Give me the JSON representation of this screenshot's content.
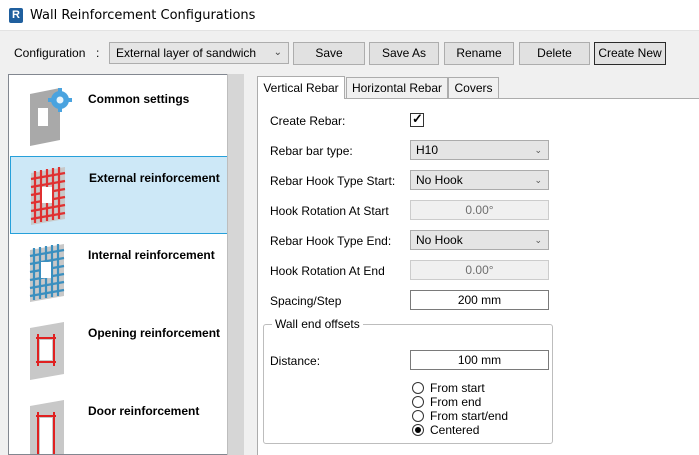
{
  "window": {
    "title": "Wall Reinforcement Configurations",
    "app_icon_letter": "R"
  },
  "toolbar": {
    "config_label": "Configuration",
    "config_colon": ":",
    "config_value": "External layer of sandwich",
    "save": "Save",
    "save_as": "Save As",
    "rename": "Rename",
    "delete": "Delete",
    "create_new": "Create New"
  },
  "sidebar": {
    "items": [
      {
        "label": "Common settings",
        "icon": "gear-wall-icon"
      },
      {
        "label": "External reinforcement",
        "icon": "red-mesh-wall-icon",
        "selected": true
      },
      {
        "label": "Internal reinforcement",
        "icon": "blue-mesh-wall-icon"
      },
      {
        "label": "Opening reinforcement",
        "icon": "opening-rebar-icon"
      },
      {
        "label": "Door reinforcement",
        "icon": "door-rebar-icon"
      }
    ]
  },
  "tabs": [
    "Vertical Rebar",
    "Horizontal Rebar",
    "Covers"
  ],
  "form": {
    "create_rebar_label": "Create Rebar:",
    "create_rebar_checked": true,
    "bar_type_label": "Rebar bar type:",
    "bar_type_value": "H10",
    "hook_start_label": "Rebar Hook Type Start:",
    "hook_start_value": "No Hook",
    "hook_rot_start_label": "Hook Rotation At Start",
    "hook_rot_start_value": "0.00°",
    "hook_end_label": "Rebar Hook Type End:",
    "hook_end_value": "No Hook",
    "hook_rot_end_label": "Hook Rotation At End",
    "hook_rot_end_value": "0.00°",
    "spacing_label": "Spacing/Step",
    "spacing_value": "200 mm"
  },
  "wall_end_offsets": {
    "legend": "Wall end offsets",
    "distance_label": "Distance:",
    "distance_value": "100 mm",
    "options": [
      {
        "label": "From start",
        "checked": false
      },
      {
        "label": "From end",
        "checked": false
      },
      {
        "label": "From start/end",
        "checked": false
      },
      {
        "label": "Centered",
        "checked": true
      }
    ]
  }
}
